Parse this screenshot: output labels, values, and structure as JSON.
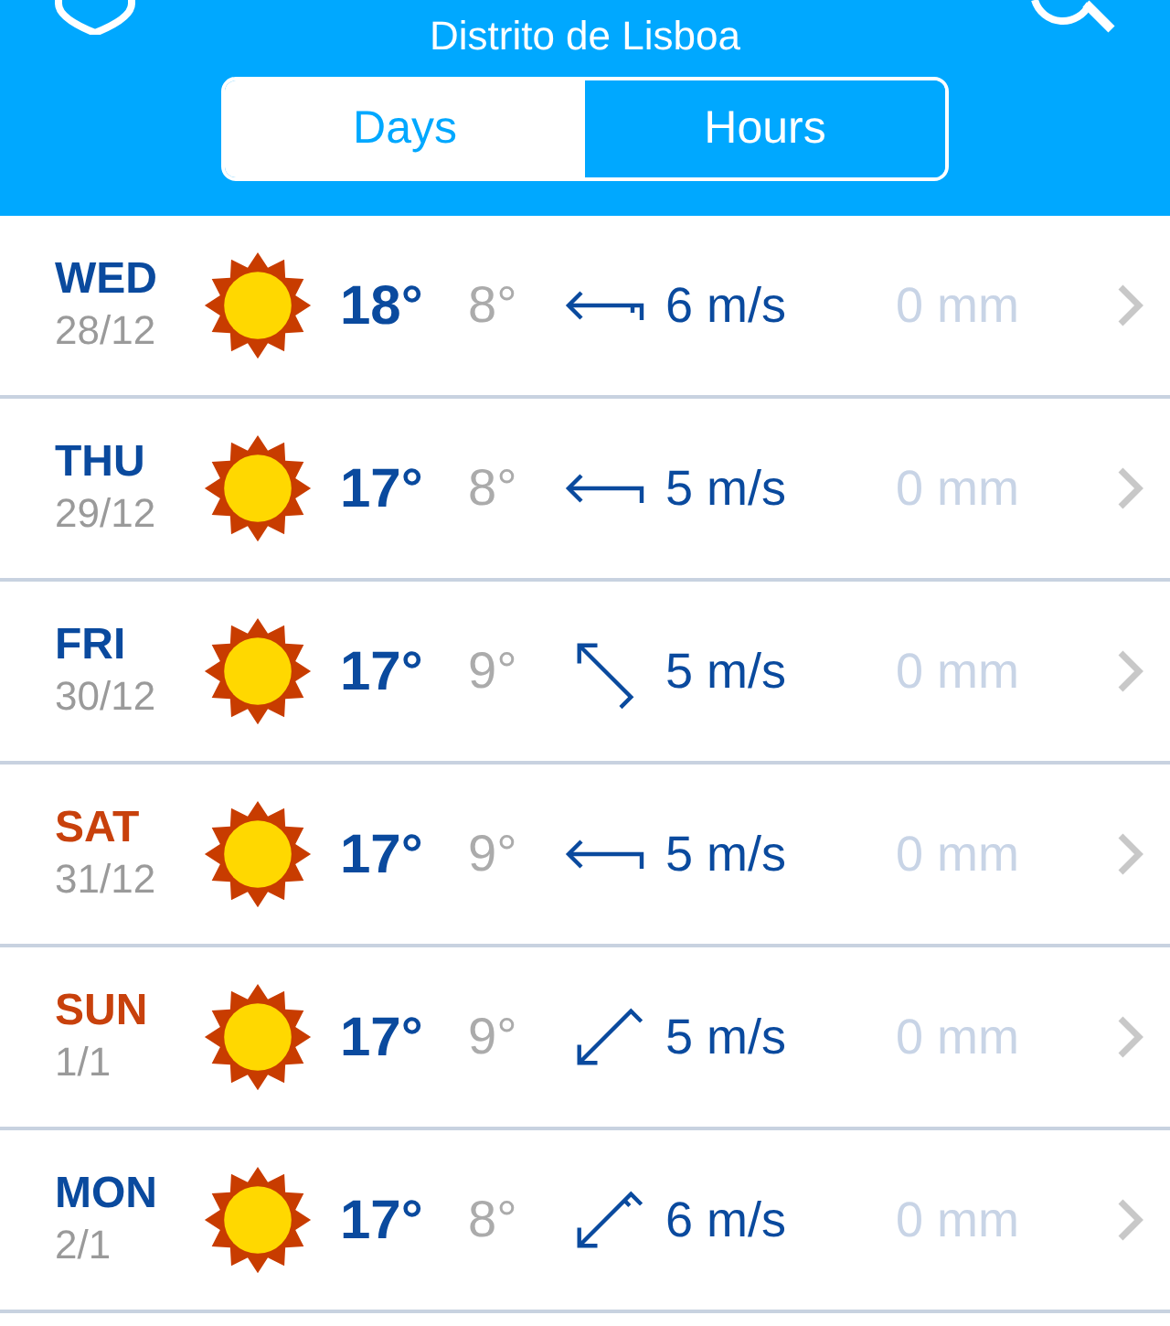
{
  "header": {
    "title": "Distrito de Lisboa"
  },
  "tabs": [
    {
      "label": "Days",
      "selected": true
    },
    {
      "label": "Hours",
      "selected": false
    }
  ],
  "days": [
    {
      "day": "WED",
      "date": "28/12",
      "weekend": false,
      "high": "18°",
      "low": "8°",
      "wind": {
        "kind": "east_half"
      },
      "speed": "6 m/s",
      "rain": "0 mm"
    },
    {
      "day": "THU",
      "date": "29/12",
      "weekend": false,
      "high": "17°",
      "low": "8°",
      "wind": {
        "kind": "east"
      },
      "speed": "5 m/s",
      "rain": "0 mm"
    },
    {
      "day": "FRI",
      "date": "30/12",
      "weekend": false,
      "high": "17°",
      "low": "9°",
      "wind": {
        "kind": "southeast"
      },
      "speed": "5 m/s",
      "rain": "0 mm"
    },
    {
      "day": "SAT",
      "date": "31/12",
      "weekend": true,
      "high": "17°",
      "low": "9°",
      "wind": {
        "kind": "east"
      },
      "speed": "5 m/s",
      "rain": "0 mm"
    },
    {
      "day": "SUN",
      "date": "1/1",
      "weekend": true,
      "high": "17°",
      "low": "9°",
      "wind": {
        "kind": "northeast"
      },
      "speed": "5 m/s",
      "rain": "0 mm"
    },
    {
      "day": "MON",
      "date": "2/1",
      "weekend": false,
      "high": "17°",
      "low": "8°",
      "wind": {
        "kind": "northeast_half"
      },
      "speed": "6 m/s",
      "rain": "0 mm"
    }
  ]
}
